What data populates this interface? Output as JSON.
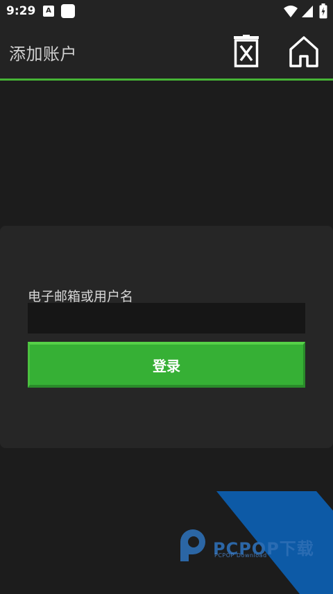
{
  "status_bar": {
    "time": "9:29",
    "notification_icons": [
      "text-app-icon",
      "white-square-icon"
    ],
    "system_icons": [
      "wifi-icon",
      "cell-signal-icon",
      "battery-charging-icon"
    ],
    "app_a_label": "A"
  },
  "toolbar": {
    "title": "添加账户",
    "actions": [
      "delete-icon",
      "home-icon"
    ]
  },
  "login_form": {
    "field_label": "电子邮箱或用户名",
    "field_value": "",
    "submit_label": "登录"
  },
  "watermark": {
    "brand": "PCPOP下载",
    "subtitle": "PCPOP Download"
  },
  "colors": {
    "accent": "#46b436",
    "button": "#36b035",
    "background": "#1c1c1c",
    "card": "#262626",
    "watermark_blue": "#0d5aa6"
  }
}
